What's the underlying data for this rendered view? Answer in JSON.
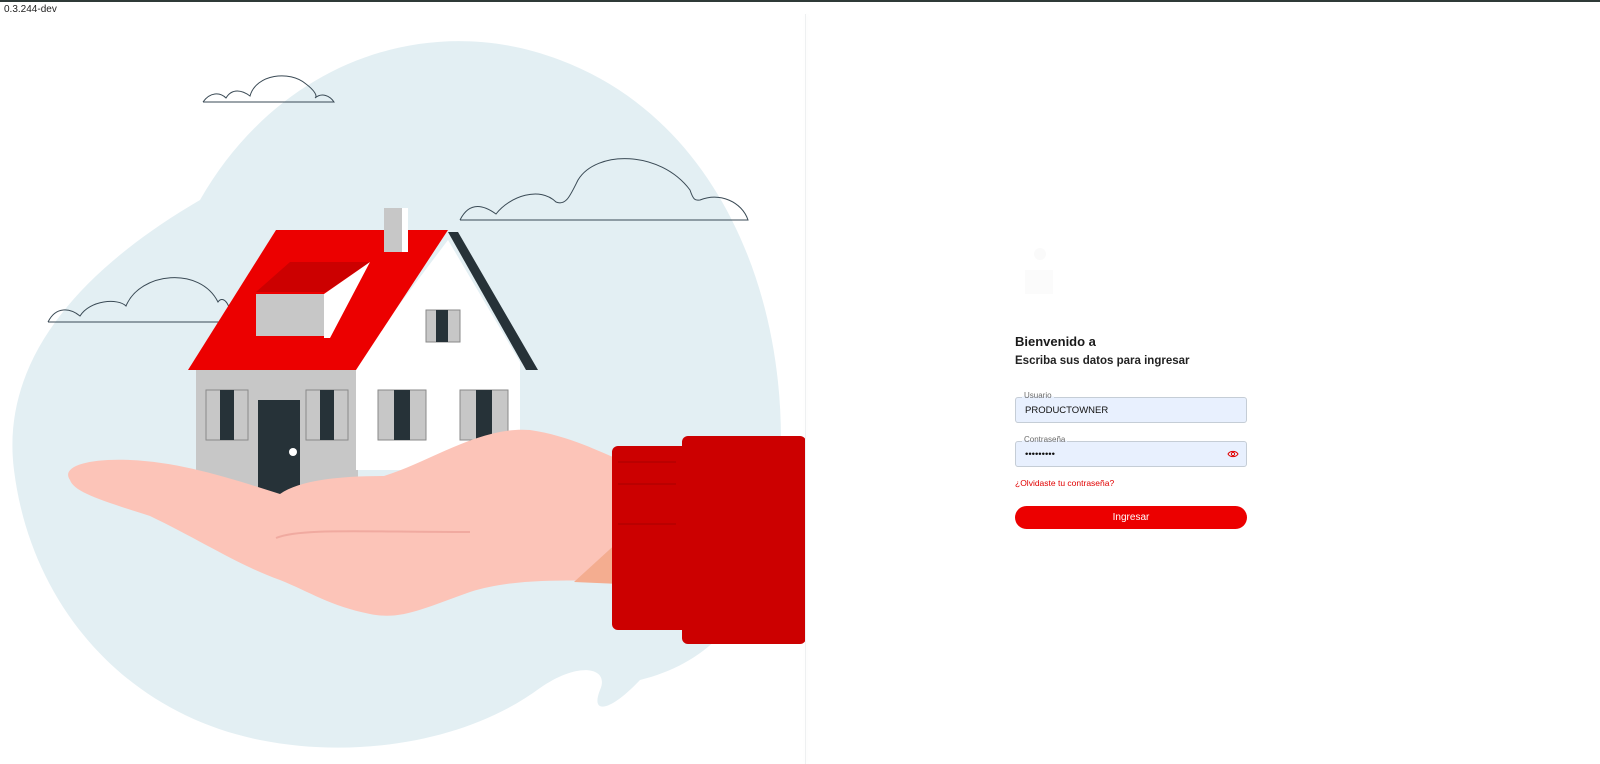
{
  "app": {
    "version": "0.3.244-dev"
  },
  "login": {
    "welcome": "Bienvenido a",
    "subtitle": "Escriba sus datos para ingresar",
    "username": {
      "label": "Usuario",
      "value": "PRODUCTOWNER"
    },
    "password": {
      "label": "Contraseña",
      "value": "•••••••••",
      "toggle_icon": "eye-icon"
    },
    "forgot_link": "¿Olvidaste tu contraseña?",
    "submit_label": "Ingresar"
  },
  "illustration": {
    "subject": "hand-holding-house"
  },
  "colors": {
    "brand_red": "#ec0000",
    "blob": "#e3eff3",
    "skin": "#fcc4b8",
    "sleeve": "#cc0000",
    "field_bg": "#e8f0fe"
  }
}
